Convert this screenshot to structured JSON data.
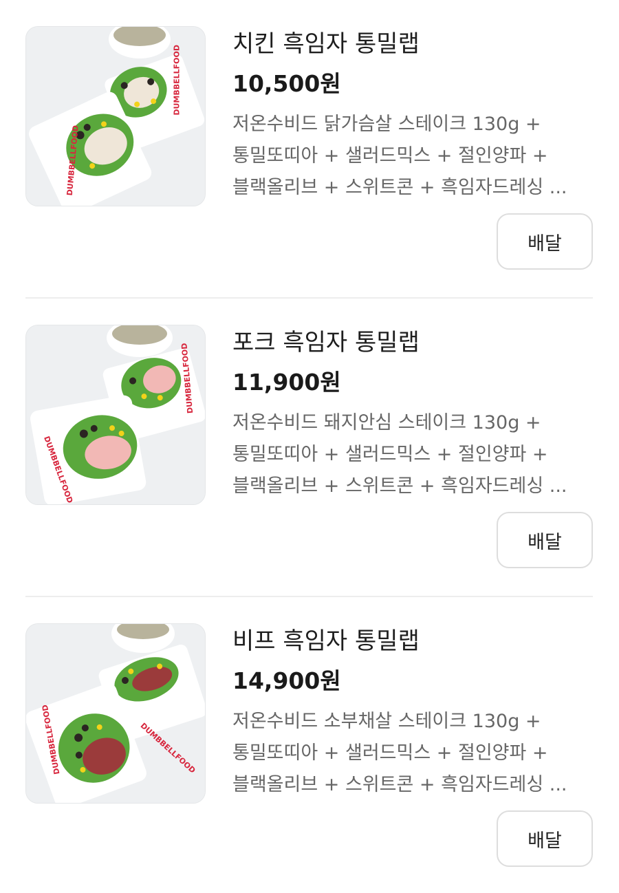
{
  "menu_items": [
    {
      "name": "치킨 흑임자 통밀랩",
      "price": "10,500원",
      "description_lines": [
        "저온수비드 닭가슴살 스테이크 130g +",
        "통밀또띠아 + 샐러드믹스 + 절인양파 +",
        "블랙올리브 + 스위트콘 + 흑임자드레싱 ..."
      ],
      "button_label": "배달",
      "wrapper_text": "DUMBBELLFOOD",
      "filling": "chicken"
    },
    {
      "name": "포크 흑임자 통밀랩",
      "price": "11,900원",
      "description_lines": [
        "저온수비드 돼지안심 스테이크 130g +",
        "통밀또띠아 + 샐러드믹스 + 절인양파 +",
        "블랙올리브 + 스위트콘 + 흑임자드레싱 ..."
      ],
      "button_label": "배달",
      "wrapper_text": "DUMBBELLFOOD",
      "filling": "pork"
    },
    {
      "name": "비프 흑임자 통밀랩",
      "price": "14,900원",
      "description_lines": [
        "저온수비드 소부채살 스테이크 130g +",
        "통밀또띠아 + 샐러드믹스 + 절인양파 +",
        "블랙올리브 + 스위트콘 + 흑임자드레싱 ..."
      ],
      "button_label": "배달",
      "wrapper_text": "DUMBBELLFOOD",
      "filling": "beef"
    }
  ],
  "colors": {
    "wrapper_print": "#d7263d",
    "chicken": "#efe6d8",
    "pork": "#f2b8b5",
    "beef": "#9b3b3b",
    "lettuce": "#5aa83c",
    "corn": "#f3d21a",
    "olive": "#2b2522",
    "sauce": "#b8b39c"
  }
}
